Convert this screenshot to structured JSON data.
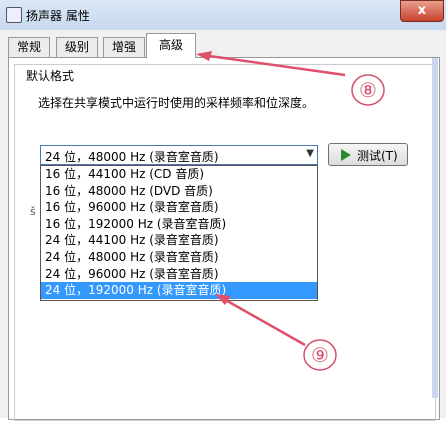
{
  "window": {
    "title": "扬声器 属性",
    "close_label": "x"
  },
  "tabs": [
    {
      "label": "常规"
    },
    {
      "label": "级别"
    },
    {
      "label": "增强"
    },
    {
      "label": "高级"
    }
  ],
  "advanced": {
    "group_label": "默认格式",
    "description": "选择在共享模式中运行时使用的采样频率和位深度。",
    "selected_format": "24 位，48000 Hz (录音室音质)",
    "test_button_label": "测试(T)",
    "stray_glyph": "š"
  },
  "dropdown_options": [
    "16 位，44100 Hz (CD 音质)",
    "16 位，48000 Hz (DVD 音质)",
    "16 位，96000 Hz (录音室音质)",
    "16 位，192000 Hz (录音室音质)",
    "24 位，44100 Hz (录音室音质)",
    "24 位，48000 Hz (录音室音质)",
    "24 位，96000 Hz (录音室音质)",
    "24 位，192000 Hz (录音室音质)"
  ],
  "annotations": [
    {
      "number": "⑧",
      "color": "#d4506a"
    },
    {
      "number": "⑨",
      "color": "#d4506a"
    }
  ]
}
